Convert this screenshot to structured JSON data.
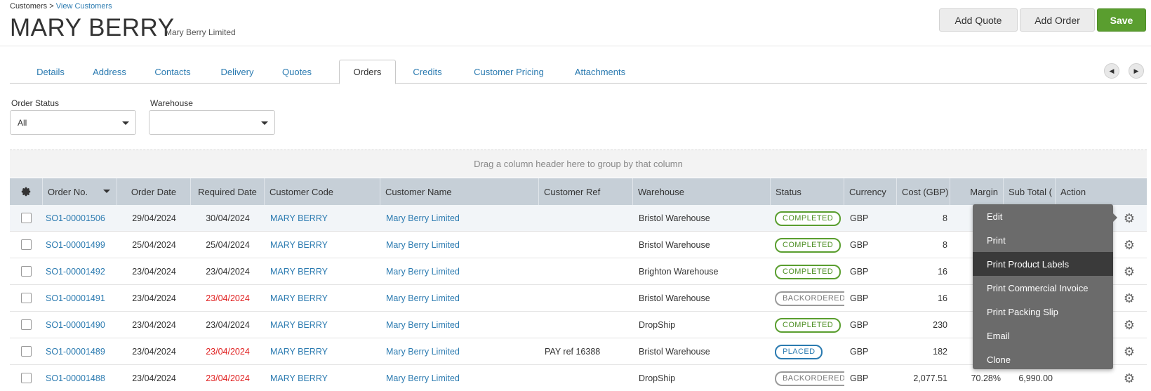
{
  "breadcrumb": {
    "root": "Customers",
    "sep": ">",
    "current": "View Customers"
  },
  "header": {
    "title": "MARY BERRY",
    "subtitle": "Mary Berry Limited"
  },
  "actions": {
    "add_quote": "Add Quote",
    "add_order": "Add Order",
    "save": "Save"
  },
  "tabs": [
    {
      "label": "Details"
    },
    {
      "label": "Address"
    },
    {
      "label": "Contacts"
    },
    {
      "label": "Delivery"
    },
    {
      "label": "Quotes"
    },
    {
      "label": "Orders",
      "active": true
    },
    {
      "label": "Credits"
    },
    {
      "label": "Customer Pricing"
    },
    {
      "label": "Attachments"
    }
  ],
  "filters": {
    "order_status": {
      "label": "Order Status",
      "value": "All"
    },
    "warehouse": {
      "label": "Warehouse",
      "value": ""
    }
  },
  "grid": {
    "group_hint": "Drag a column header here to group by that column",
    "columns": [
      "Order No.",
      "Order Date",
      "Required Date",
      "Customer Code",
      "Customer Name",
      "Customer Ref",
      "Warehouse",
      "Status",
      "Currency",
      "Cost (GBP)",
      "Margin",
      "Sub Total (",
      "Action"
    ],
    "rows": [
      {
        "order_no": "SO1-00001506",
        "order_date": "29/04/2024",
        "required_date": "30/04/2024",
        "overdue": false,
        "customer_code": "MARY BERRY",
        "customer_name": "Mary Berry Limited",
        "customer_ref": "",
        "warehouse": "Bristol Warehouse",
        "status": "COMPLETED",
        "currency": "GBP",
        "cost": "8",
        "margin": "",
        "sub_total": ""
      },
      {
        "order_no": "SO1-00001499",
        "order_date": "25/04/2024",
        "required_date": "25/04/2024",
        "overdue": false,
        "customer_code": "MARY BERRY",
        "customer_name": "Mary Berry Limited",
        "customer_ref": "",
        "warehouse": "Bristol Warehouse",
        "status": "COMPLETED",
        "currency": "GBP",
        "cost": "8",
        "margin": "",
        "sub_total": ""
      },
      {
        "order_no": "SO1-00001492",
        "order_date": "23/04/2024",
        "required_date": "23/04/2024",
        "overdue": false,
        "customer_code": "MARY BERRY",
        "customer_name": "Mary Berry Limited",
        "customer_ref": "",
        "warehouse": "Brighton Warehouse",
        "status": "COMPLETED",
        "currency": "GBP",
        "cost": "16",
        "margin": "",
        "sub_total": ""
      },
      {
        "order_no": "SO1-00001491",
        "order_date": "23/04/2024",
        "required_date": "23/04/2024",
        "overdue": true,
        "customer_code": "MARY BERRY",
        "customer_name": "Mary Berry Limited",
        "customer_ref": "",
        "warehouse": "Bristol Warehouse",
        "status": "BACKORDERED",
        "currency": "GBP",
        "cost": "16",
        "margin": "",
        "sub_total": ""
      },
      {
        "order_no": "SO1-00001490",
        "order_date": "23/04/2024",
        "required_date": "23/04/2024",
        "overdue": false,
        "customer_code": "MARY BERRY",
        "customer_name": "Mary Berry Limited",
        "customer_ref": "",
        "warehouse": "DropShip",
        "status": "COMPLETED",
        "currency": "GBP",
        "cost": "230",
        "margin": "",
        "sub_total": ""
      },
      {
        "order_no": "SO1-00001489",
        "order_date": "23/04/2024",
        "required_date": "23/04/2024",
        "overdue": true,
        "customer_code": "MARY BERRY",
        "customer_name": "Mary Berry Limited",
        "customer_ref": "PAY ref 16388",
        "warehouse": "Bristol Warehouse",
        "status": "PLACED",
        "currency": "GBP",
        "cost": "182",
        "margin": "",
        "sub_total": ""
      },
      {
        "order_no": "SO1-00001488",
        "order_date": "23/04/2024",
        "required_date": "23/04/2024",
        "overdue": true,
        "customer_code": "MARY BERRY",
        "customer_name": "Mary Berry Limited",
        "customer_ref": "",
        "warehouse": "DropShip",
        "status": "BACKORDERED",
        "currency": "GBP",
        "cost": "2,077.51",
        "margin": "70.28%",
        "sub_total": "6,990.00"
      }
    ]
  },
  "action_menu": {
    "items": [
      "Edit",
      "Print",
      "Print Product Labels",
      "Print Commercial Invoice",
      "Print Packing Slip",
      "Email",
      "Clone"
    ],
    "highlighted": "Print Product Labels"
  },
  "colors": {
    "link": "#2a7ab0",
    "save": "#5a9e2f",
    "overdue": "#e02020",
    "header_bg": "#c6cfd7",
    "menu_bg": "#6b6b6b"
  }
}
